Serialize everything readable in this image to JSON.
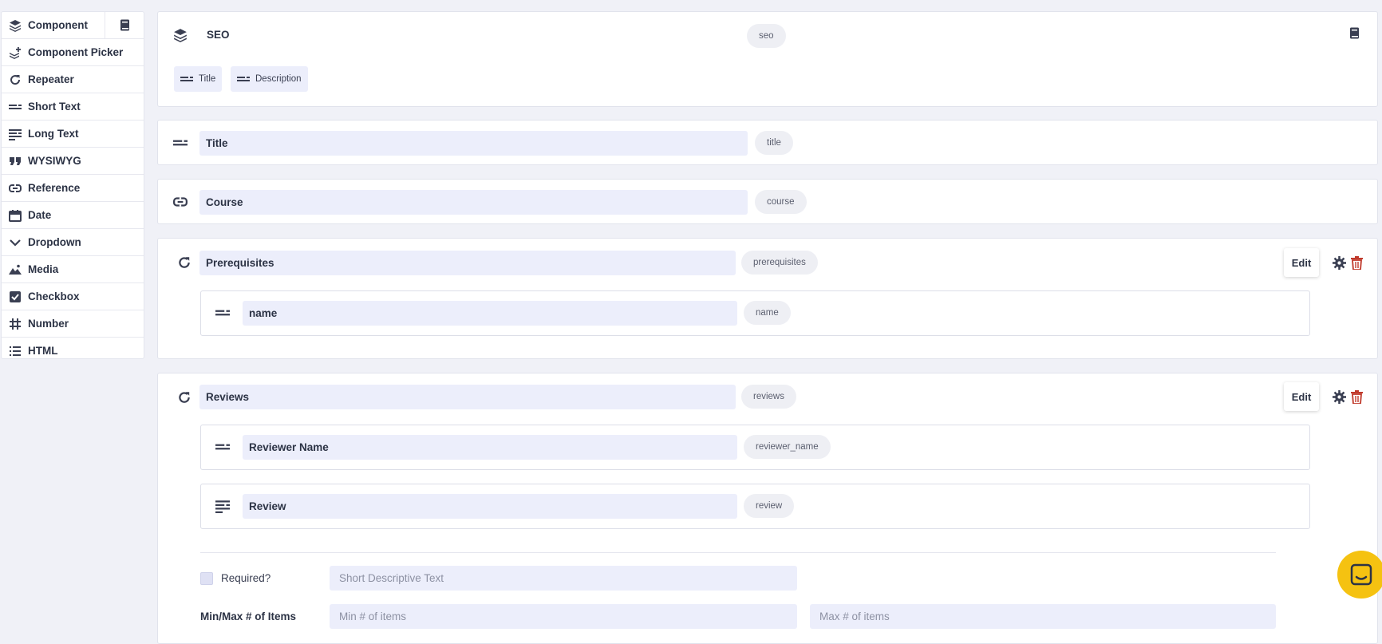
{
  "sidebar": {
    "items": [
      {
        "label": "Component",
        "icon": "layers-icon"
      },
      {
        "label": "Component Picker",
        "icon": "layers-plus-icon"
      },
      {
        "label": "Repeater",
        "icon": "repeat-icon"
      },
      {
        "label": "Short Text",
        "icon": "short-text-icon"
      },
      {
        "label": "Long Text",
        "icon": "long-text-icon"
      },
      {
        "label": "WYSIWYG",
        "icon": "quote-icon"
      },
      {
        "label": "Reference",
        "icon": "link-icon"
      },
      {
        "label": "Date",
        "icon": "calendar-icon"
      },
      {
        "label": "Dropdown",
        "icon": "chevron-down-icon"
      },
      {
        "label": "Media",
        "icon": "image-icon"
      },
      {
        "label": "Checkbox",
        "icon": "checkbox-icon"
      },
      {
        "label": "Number",
        "icon": "hash-icon"
      },
      {
        "label": "HTML",
        "icon": "list-icon"
      }
    ],
    "book_icon": "book-icon"
  },
  "seo": {
    "title": "SEO",
    "key": "seo",
    "chips": [
      {
        "label": "Title"
      },
      {
        "label": "Description"
      }
    ]
  },
  "fields": {
    "title": {
      "label": "Title",
      "key": "title"
    },
    "course": {
      "label": "Course",
      "key": "course"
    },
    "prerequisites": {
      "label": "Prerequisites",
      "key": "prerequisites",
      "edit_label": "Edit",
      "children": [
        {
          "label": "name",
          "key": "name"
        }
      ]
    },
    "reviews": {
      "label": "Reviews",
      "key": "reviews",
      "edit_label": "Edit",
      "children": [
        {
          "label": "Reviewer Name",
          "key": "reviewer_name"
        },
        {
          "label": "Review",
          "key": "review"
        }
      ],
      "required_label": "Required?",
      "description_placeholder": "Short Descriptive Text",
      "minmax_label": "Min/Max # of Items",
      "min_placeholder": "Min # of items",
      "max_placeholder": "Max # of items"
    }
  },
  "colors": {
    "accent_input": "#eceefb",
    "delete": "#c0392b",
    "help": "#f5c211"
  }
}
